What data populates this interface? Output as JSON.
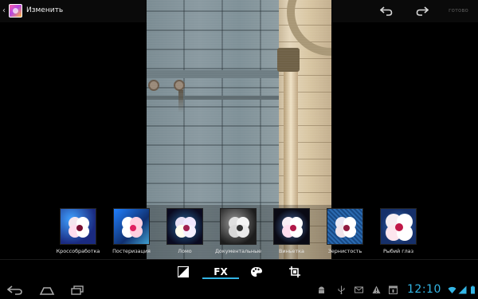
{
  "action_bar": {
    "title": "Изменить",
    "done_label": "готово",
    "undo_icon": "undo-icon",
    "redo_icon": "redo-icon"
  },
  "filters": [
    {
      "label": "Кроссобработка",
      "selected": false
    },
    {
      "label": "Постеризация",
      "selected": false
    },
    {
      "label": "Ломо",
      "selected": false
    },
    {
      "label": "Документальные",
      "selected": false
    },
    {
      "label": "Виньетка",
      "selected": false
    },
    {
      "label": "Зернистость",
      "selected": false
    },
    {
      "label": "Рыбий глаз",
      "selected": false
    }
  ],
  "toolbar": {
    "fx_label": "FX",
    "active_tab": "fx",
    "tools": [
      "autofix-icon",
      "fx-tab",
      "palette-icon",
      "crop-icon"
    ]
  },
  "system_bar": {
    "time": "12:10",
    "nav": [
      "back-icon",
      "home-icon",
      "recent-apps-icon"
    ],
    "notifications": [
      "debug-android-icon",
      "usb-icon",
      "gmail-icon",
      "warning-icon",
      "calendar-icon"
    ]
  },
  "colors": {
    "accent": "#33b5e5",
    "background": "#000000"
  }
}
